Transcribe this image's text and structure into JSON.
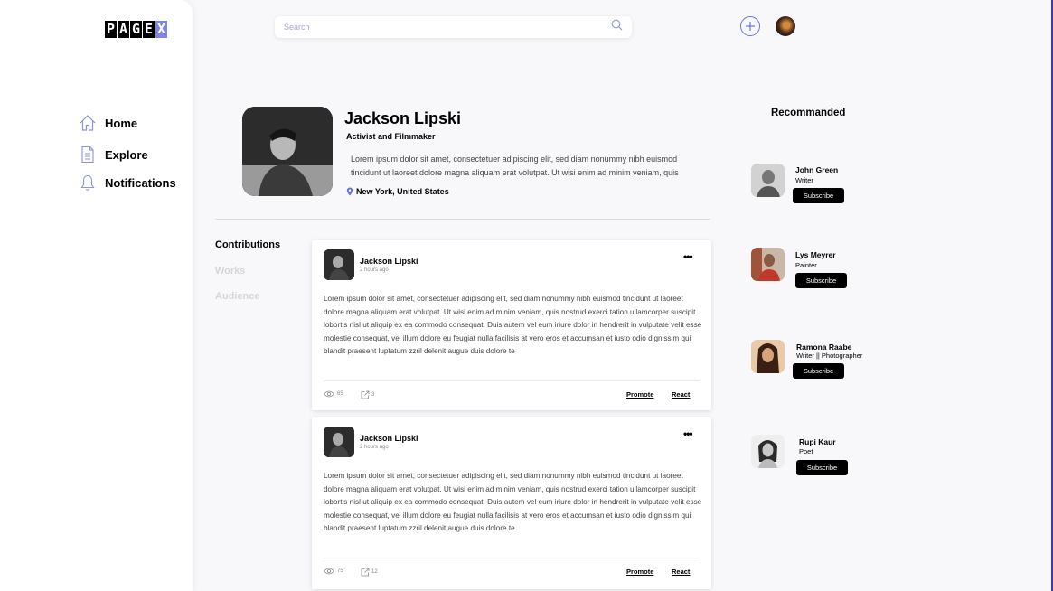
{
  "brand": {
    "letters": [
      "P",
      "A",
      "G",
      "E",
      "X"
    ],
    "accent_color": "#7d86e8"
  },
  "nav": {
    "items": [
      {
        "label": "Home",
        "icon": "home-icon"
      },
      {
        "label": "Explore",
        "icon": "document-icon"
      },
      {
        "label": "Notifications",
        "icon": "bell-icon"
      }
    ]
  },
  "search": {
    "placeholder": "Search",
    "icon": "search-icon"
  },
  "topbar": {
    "add_icon": "plus-icon",
    "avatar": "user-avatar"
  },
  "profile": {
    "name": "Jackson Lipski",
    "title": "Activist and Filmmaker",
    "bio": "Lorem ipsum dolor sit amet, consectetuer adipiscing elit, sed diam nonummy nibh euismod tincidunt ut laoreet dolore magna aliquam erat volutpat. Ut wisi enim ad minim veniam, quis",
    "location": "New York, United States"
  },
  "tabs": [
    {
      "label": "Contributions",
      "active": true
    },
    {
      "label": "Works",
      "active": false
    },
    {
      "label": "Audience",
      "active": false
    }
  ],
  "posts": [
    {
      "author": "Jackson Lipski",
      "time": "2 hours ago",
      "body": "Lorem ipsum dolor sit amet, consectetuer adipiscing elit, sed diam nonummy nibh euismod tincidunt ut laoreet dolore magna aliquam erat volutpat. Ut wisi enim ad minim veniam, quis nostrud exerci tation ullamcorper suscipit lobortis nisl ut aliquip ex ea commodo consequat. Duis autem vel eum iriure dolor in hendrerit in vulputate velit esse molestie consequat, vel illum dolore eu feugiat nulla facilisis at vero eros et accumsan et iusto odio dignissim qui blandit praesent luptatum zzril delenit augue duis dolore te",
      "views": "65",
      "shares": "3",
      "promote": "Promote",
      "react": "React"
    },
    {
      "author": "Jackson Lipski",
      "time": "2 hours ago",
      "body": "Lorem ipsum dolor sit amet, consectetuer adipiscing elit, sed diam nonummy nibh euismod tincidunt ut laoreet dolore magna aliquam erat volutpat. Ut wisi enim ad minim veniam, quis nostrud exerci tation ullamcorper suscipit lobortis nisl ut aliquip ex ea commodo consequat. Duis autem vel eum iriure dolor in hendrerit in vulputate velit esse molestie consequat, vel illum dolore eu feugiat nulla facilisis at vero eros et accumsan et iusto odio dignissim qui blandit praesent luptatum zzril delenit augue duis dolore te",
      "views": "75",
      "shares": "12",
      "promote": "Promote",
      "react": "React"
    }
  ],
  "recommended": {
    "heading": "Recommanded",
    "users": [
      {
        "name": "John Green",
        "role": "Writer",
        "button": "Subscribe"
      },
      {
        "name": "Lys Meyrer",
        "role": "Painter",
        "button": "Subscribe"
      },
      {
        "name": "Ramona Raabe",
        "role": "Writer || Photographer",
        "button": "Subscribe"
      },
      {
        "name": "Rupi Kaur",
        "role": "Poet",
        "button": "Subscribe"
      }
    ]
  }
}
